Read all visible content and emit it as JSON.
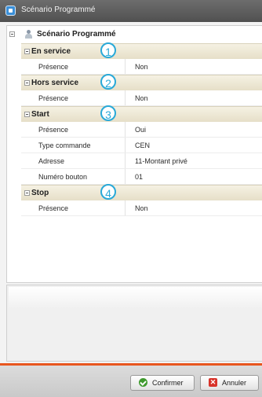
{
  "window": {
    "title": "Scénario Programmé"
  },
  "tree": {
    "root_label": "Scénario Programmé",
    "categories": [
      {
        "label": "En service",
        "badge": "1",
        "rows": [
          {
            "key": "Présence",
            "value": "Non"
          }
        ]
      },
      {
        "label": "Hors service",
        "badge": "2",
        "rows": [
          {
            "key": "Présence",
            "value": "Non"
          }
        ]
      },
      {
        "label": "Start",
        "badge": "3",
        "rows": [
          {
            "key": "Présence",
            "value": "Oui"
          },
          {
            "key": "Type commande",
            "value": "CEN"
          },
          {
            "key": "Adresse",
            "value": "11-Montant privé"
          },
          {
            "key": "Numéro bouton",
            "value": "01"
          }
        ]
      },
      {
        "label": "Stop",
        "badge": "4",
        "rows": [
          {
            "key": "Présence",
            "value": "Non"
          }
        ]
      }
    ]
  },
  "footer": {
    "confirm_label": "Confirmer",
    "cancel_label": "Annuler"
  },
  "colors": {
    "accent_bar": "#e8561e",
    "badge": "#29a9d8",
    "category_bg": "#efe9d5"
  }
}
